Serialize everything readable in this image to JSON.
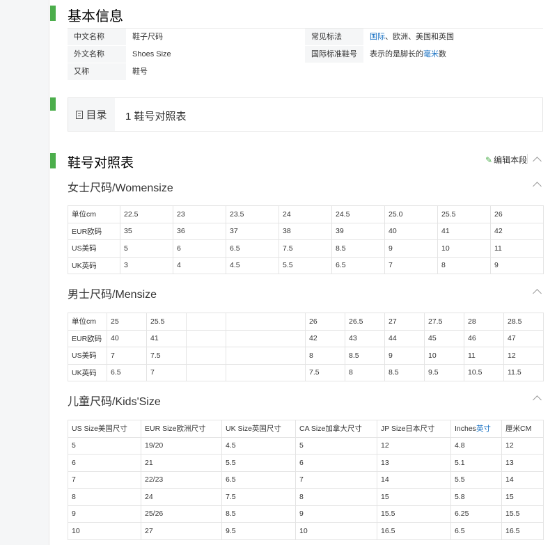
{
  "basic_info": {
    "title": "基本信息",
    "rows": [
      [
        {
          "label": "中文名称",
          "value": "鞋子尺码"
        },
        {
          "label": "常见标法",
          "value_parts": [
            {
              "text": "国际",
              "link": true
            },
            {
              "text": "、欧洲、美国和英国",
              "link": false
            }
          ]
        }
      ],
      [
        {
          "label": "外文名称",
          "value": "Shoes Size"
        },
        {
          "label": "国际标准鞋号",
          "value_parts": [
            {
              "text": "表示的是脚长的",
              "link": false
            },
            {
              "text": "毫米",
              "link": true
            },
            {
              "text": "数",
              "link": false
            }
          ]
        }
      ],
      [
        {
          "label": "又称",
          "value": "鞋号"
        }
      ]
    ]
  },
  "toc": {
    "title": "目录",
    "items": [
      {
        "num": "1",
        "label": "鞋号对照表"
      }
    ]
  },
  "section": {
    "title": "鞋号对照表",
    "edit_label": "编辑本段"
  },
  "women": {
    "title": "女士尺码/Womensize",
    "rows": [
      [
        "单位cm",
        "22.5",
        "23",
        "23.5",
        "24",
        "24.5",
        "25.0",
        "25.5",
        "26"
      ],
      [
        "EUR欧码",
        "35",
        "36",
        "37",
        "38",
        "39",
        "40",
        "41",
        "42"
      ],
      [
        "US美码",
        "5",
        "6",
        "6.5",
        "7.5",
        "8.5",
        "9",
        "10",
        "11"
      ],
      [
        "UK英码",
        "3",
        "4",
        "4.5",
        "5.5",
        "6.5",
        "7",
        "8",
        "9"
      ]
    ]
  },
  "men": {
    "title": "男士尺码/Mensize",
    "rows": [
      [
        "单位cm",
        "25",
        "25.5",
        "",
        "",
        "26",
        "26.5",
        "27",
        "27.5",
        "28",
        "28.5"
      ],
      [
        "EUR欧码",
        "40",
        "41",
        "",
        "",
        "42",
        "43",
        "44",
        "45",
        "46",
        "47"
      ],
      [
        "US美码",
        "7",
        "7.5",
        "",
        "",
        "8",
        "8.5",
        "9",
        "10",
        "11",
        "12"
      ],
      [
        "UK英码",
        "6.5",
        "7",
        "",
        "",
        "7.5",
        "8",
        "8.5",
        "9.5",
        "10.5",
        "11.5"
      ]
    ]
  },
  "kids": {
    "title": "儿童尺码/Kids'Size",
    "headers": [
      "US Size美国尺寸",
      "EUR Size欧洲尺寸",
      "UK Size英国尺寸",
      "CA Size加拿大尺寸",
      "JP Size日本尺寸",
      "Inches",
      "英寸",
      "厘米CM"
    ],
    "rows": [
      [
        "5",
        "19/20",
        "4.5",
        "5",
        "12",
        "4.8",
        "12"
      ],
      [
        "6",
        "21",
        "5.5",
        "6",
        "13",
        "5.1",
        "13"
      ],
      [
        "7",
        "22/23",
        "6.5",
        "7",
        "14",
        "5.5",
        "14"
      ],
      [
        "8",
        "24",
        "7.5",
        "8",
        "15",
        "5.8",
        "15"
      ],
      [
        "9",
        "25/26",
        "8.5",
        "9",
        "15.5",
        "6.25",
        "15.5"
      ],
      [
        "10",
        "27",
        "9.5",
        "10",
        "16.5",
        "6.5",
        "16.5"
      ]
    ]
  },
  "colors": {
    "accent_green": "#4cae4c",
    "link_blue": "#136ec2",
    "label_bg": "#f5f6f7",
    "border": "#e4e4e4"
  },
  "icons": [
    "section-bar-icon",
    "list-icon",
    "pencil-icon",
    "chevron-up-icon"
  ]
}
